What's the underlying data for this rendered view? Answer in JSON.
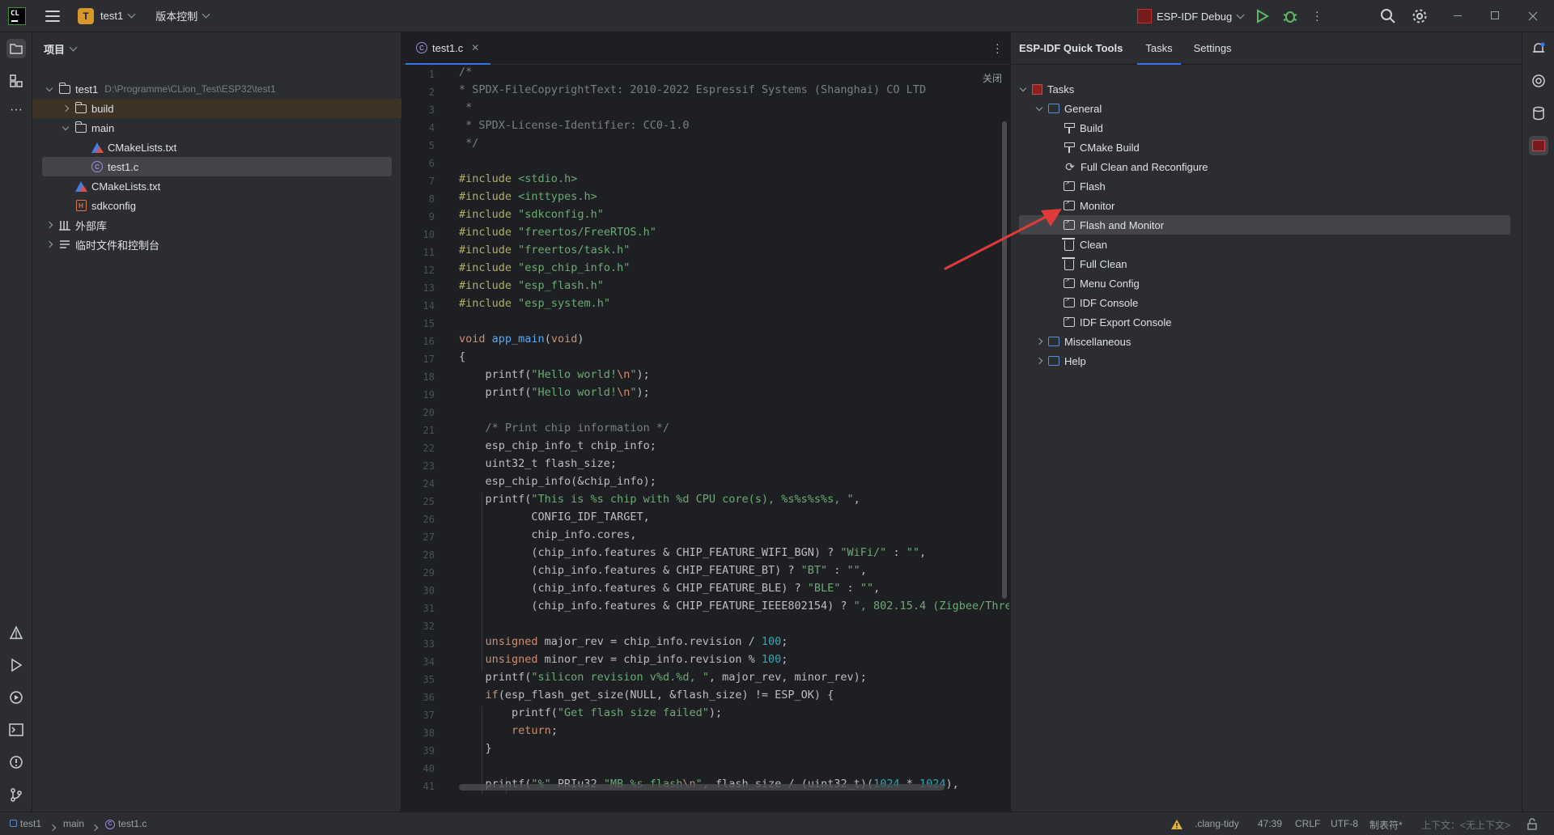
{
  "titlebar": {
    "project_badge": "T",
    "project_name": "test1",
    "vcs_label": "版本控制",
    "run_config": "ESP-IDF Debug"
  },
  "project_panel": {
    "title": "项目",
    "tree": [
      {
        "label": "test1",
        "path": "D:\\Programme\\CLion_Test\\ESP32\\test1"
      },
      {
        "label": "build"
      },
      {
        "label": "main"
      },
      {
        "label": "CMakeLists.txt"
      },
      {
        "label": "test1.c"
      },
      {
        "label": "CMakeLists.txt"
      },
      {
        "label": "sdkconfig"
      },
      {
        "label": "外部库"
      },
      {
        "label": "临时文件和控制台"
      }
    ]
  },
  "editor": {
    "tab_label": "test1.c",
    "close_label": "关闭",
    "line_numbers": [
      "1",
      "2",
      "3",
      "4",
      "5",
      "6",
      "7",
      "8",
      "9",
      "10",
      "11",
      "12",
      "13",
      "14",
      "15",
      "16",
      "17",
      "18",
      "19",
      "20",
      "21",
      "22",
      "23",
      "24",
      "25",
      "26",
      "27",
      "28",
      "29",
      "30",
      "31",
      "32",
      "33",
      "34",
      "35",
      "36",
      "37",
      "38",
      "39",
      "40",
      "41"
    ]
  },
  "quick_tools": {
    "title": "ESP-IDF Quick Tools",
    "tabs": [
      "Tasks",
      "Settings"
    ],
    "root": "Tasks",
    "group": "General",
    "tasks": [
      "Build",
      "CMake Build",
      "Full Clean and Reconfigure",
      "Flash",
      "Monitor",
      "Flash and Monitor",
      "Clean",
      "Full Clean",
      "Menu Config",
      "IDF Console",
      "IDF Export Console"
    ],
    "other_groups": [
      "Miscellaneous",
      "Help"
    ]
  },
  "statusbar": {
    "breadcrumb": [
      "test1",
      "main",
      "test1.c"
    ],
    "linter": ".clang-tidy",
    "position": "47:39",
    "line_ending": "CRLF",
    "encoding": "UTF-8",
    "indent": "制表符*",
    "context": "上下文：<无上下文>"
  },
  "colors": {
    "accent": "#3574f0",
    "arrow": "#e03a3a",
    "badge": "#d8972a"
  }
}
